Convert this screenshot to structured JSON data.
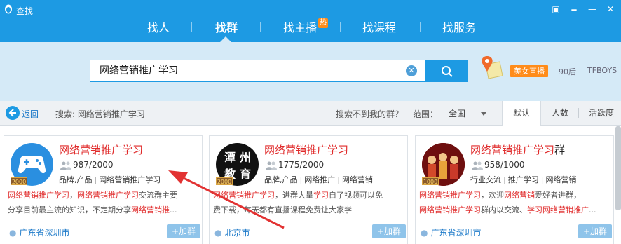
{
  "window": {
    "title": "查找",
    "controls": [
      "▣",
      "🗕",
      "—",
      "✕"
    ]
  },
  "nav": {
    "items": [
      {
        "label": "找人",
        "active": false
      },
      {
        "label": "找群",
        "active": true
      },
      {
        "label": "找主播",
        "active": false,
        "badge": "热"
      },
      {
        "label": "找课程",
        "active": false
      },
      {
        "label": "找服务",
        "active": false
      }
    ]
  },
  "search": {
    "value": "网络营销推广学习",
    "clear_glyph": "✕",
    "hot_tags": [
      "美女直播",
      "90后",
      "TFBOYS"
    ]
  },
  "filter": {
    "back_label": "返回",
    "breadcrumb": "搜索: 网络营销推广学习",
    "not_found": "搜索不到我的群？",
    "range_label": "范围：",
    "range_value": "全国",
    "sort_tabs": [
      "默认",
      "人数",
      "活跃度"
    ],
    "sort_active": "默认"
  },
  "cards": [
    {
      "title": "网络营销推广学习",
      "title_suffix": "",
      "members": "987/2000",
      "level": "2000",
      "tags": [
        "品牌,产品",
        "网络营销推广学习"
      ],
      "desc_line1": [
        {
          "t": "网络营销推广学习",
          "hl": true
        },
        {
          "t": "，",
          "hl": false
        },
        {
          "t": "网络营销推广学习",
          "hl": true
        },
        {
          "t": "交流群主要",
          "hl": false
        }
      ],
      "desc_line2": [
        {
          "t": "分享目前最主流的知识，不定期分享",
          "hl": false
        },
        {
          "t": "网络营销推",
          "hl": true
        },
        {
          "t": "...",
          "hl": false
        }
      ],
      "location": "广东省深圳市",
      "join": "+加群"
    },
    {
      "title": "网络营销推广学习",
      "title_suffix": "",
      "members": "1775/2000",
      "level": "2000",
      "avatar_text": [
        "潭",
        "州",
        "教",
        "育"
      ],
      "tags": [
        "品牌,产品",
        "网络推广",
        "网络营销"
      ],
      "desc_line1": [
        {
          "t": "网络营销推广学习",
          "hl": true
        },
        {
          "t": "，进群大量",
          "hl": false
        },
        {
          "t": "学习",
          "hl": true
        },
        {
          "t": "自了视频可以免",
          "hl": false
        }
      ],
      "desc_line2": [
        {
          "t": "费下载，每天都有直播课程免费让大家学",
          "hl": false
        }
      ],
      "location": "北京市",
      "join": "+加群"
    },
    {
      "title": "网络营销推广学习",
      "title_suffix": "群",
      "members": "958/1000",
      "level": "1000",
      "tags": [
        "行业交流",
        "推广学习",
        "网络营销"
      ],
      "desc_line1": [
        {
          "t": "网络营销推广学习",
          "hl": true
        },
        {
          "t": "，欢迎",
          "hl": false
        },
        {
          "t": "网络营销",
          "hl": true
        },
        {
          "t": "爱好者进群，",
          "hl": false
        }
      ],
      "desc_line2": [
        {
          "t": "网络营销推广学习",
          "hl": true
        },
        {
          "t": "群内以交流、",
          "hl": false
        },
        {
          "t": "学习网络营销推广",
          "hl": true
        },
        {
          "t": "...",
          "hl": false
        }
      ],
      "location": "广东省深圳市",
      "join": "+加群"
    }
  ],
  "colors": {
    "brand_blue": "#1d9ae3",
    "highlight_red": "#e02a2a",
    "hot_orange": "#ff8c1a"
  }
}
